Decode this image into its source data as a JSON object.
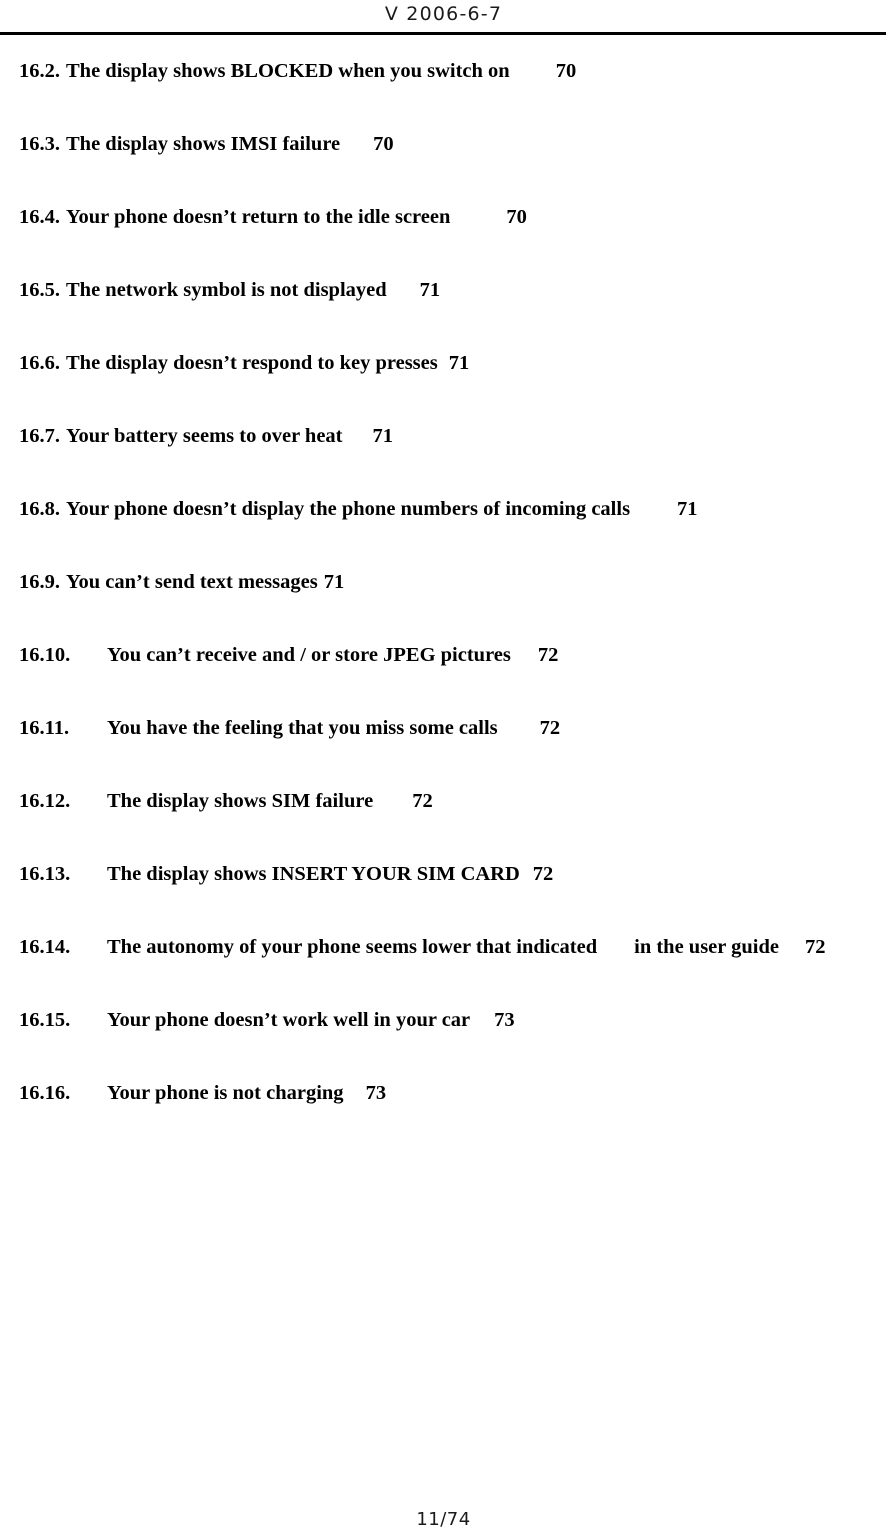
{
  "header": {
    "version_text": "V 2006-6-7"
  },
  "footer": {
    "page_indicator": "11/74"
  },
  "toc": {
    "entries": [
      {
        "number": "16.2.",
        "title": "The display shows BLOCKED when you switch on",
        "page": "70",
        "level": "a",
        "gap": 46,
        "extra": "",
        "extra_gap": 0
      },
      {
        "number": "16.3.",
        "title": "The display shows IMSI failure",
        "page": "70",
        "level": "a",
        "gap": 33,
        "extra": "",
        "extra_gap": 0
      },
      {
        "number": "16.4.",
        "title": "Your phone doesn’t return to the idle screen",
        "page": "70",
        "level": "a",
        "gap": 56,
        "extra": "",
        "extra_gap": 0
      },
      {
        "number": "16.5.",
        "title": "The network symbol is not displayed",
        "page": "71",
        "level": "a",
        "gap": 33,
        "extra": "",
        "extra_gap": 0
      },
      {
        "number": "16.6.",
        "title": "The display doesn’t respond to key presses",
        "page": "71",
        "level": "a",
        "gap": 11,
        "extra": "",
        "extra_gap": 0
      },
      {
        "number": "16.7.",
        "title": "Your battery seems to over heat",
        "page": "71",
        "level": "a",
        "gap": 30,
        "extra": "",
        "extra_gap": 0
      },
      {
        "number": "16.8.",
        "title": "Your phone doesn’t display the phone numbers of incoming calls",
        "page": "71",
        "level": "a",
        "gap": 47,
        "extra": "",
        "extra_gap": 0
      },
      {
        "number": "16.9.",
        "title": "You can’t send text messages",
        "page": "71",
        "level": "a",
        "gap": 6,
        "extra": "",
        "extra_gap": 0
      },
      {
        "number": "16.10.",
        "title": "You can’t receive and / or store JPEG pictures",
        "page": "72",
        "level": "b",
        "gap": 27,
        "extra": "",
        "extra_gap": 0
      },
      {
        "number": "16.11.",
        "title": "You have the feeling that you miss some calls",
        "page": "72",
        "level": "b",
        "gap": 42,
        "extra": "",
        "extra_gap": 0
      },
      {
        "number": "16.12.",
        "title": "The display shows SIM failure",
        "page": "72",
        "level": "b",
        "gap": 39,
        "extra": "",
        "extra_gap": 0
      },
      {
        "number": "16.13.",
        "title": "The display shows INSERT YOUR SIM CARD",
        "page": "72",
        "level": "b",
        "gap": 13,
        "extra": "",
        "extra_gap": 0
      },
      {
        "number": "16.14.",
        "title": "The autonomy of your phone seems lower that indicated",
        "page": "72",
        "level": "b",
        "gap": 37,
        "extra": "in the user guide",
        "extra_gap": 26
      },
      {
        "number": "16.15.",
        "title": "Your phone doesn’t work well in your car",
        "page": "73",
        "level": "b",
        "gap": 24,
        "extra": "",
        "extra_gap": 0
      },
      {
        "number": "16.16.",
        "title": "Your phone is not charging",
        "page": "73",
        "level": "b",
        "gap": 22,
        "extra": "",
        "extra_gap": 0
      }
    ]
  }
}
